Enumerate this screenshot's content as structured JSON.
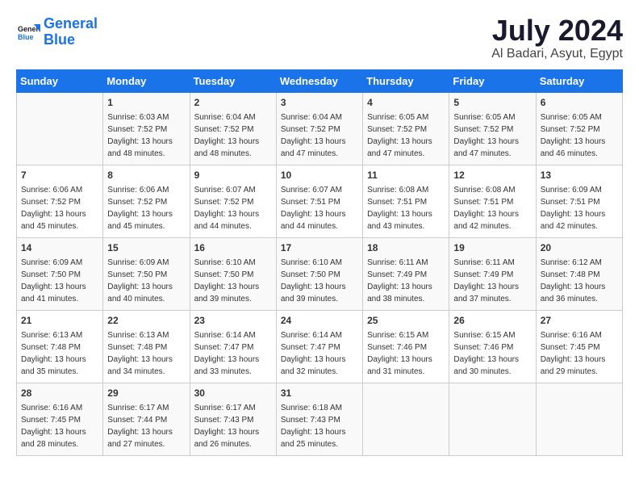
{
  "header": {
    "logo_line1": "General",
    "logo_line2": "Blue",
    "month": "July 2024",
    "location": "Al Badari, Asyut, Egypt"
  },
  "weekdays": [
    "Sunday",
    "Monday",
    "Tuesday",
    "Wednesday",
    "Thursday",
    "Friday",
    "Saturday"
  ],
  "weeks": [
    [
      {
        "day": "",
        "sunrise": "",
        "sunset": "",
        "daylight": ""
      },
      {
        "day": "1",
        "sunrise": "6:03 AM",
        "sunset": "7:52 PM",
        "daylight": "13 hours and 48 minutes."
      },
      {
        "day": "2",
        "sunrise": "6:04 AM",
        "sunset": "7:52 PM",
        "daylight": "13 hours and 48 minutes."
      },
      {
        "day": "3",
        "sunrise": "6:04 AM",
        "sunset": "7:52 PM",
        "daylight": "13 hours and 47 minutes."
      },
      {
        "day": "4",
        "sunrise": "6:05 AM",
        "sunset": "7:52 PM",
        "daylight": "13 hours and 47 minutes."
      },
      {
        "day": "5",
        "sunrise": "6:05 AM",
        "sunset": "7:52 PM",
        "daylight": "13 hours and 47 minutes."
      },
      {
        "day": "6",
        "sunrise": "6:05 AM",
        "sunset": "7:52 PM",
        "daylight": "13 hours and 46 minutes."
      }
    ],
    [
      {
        "day": "7",
        "sunrise": "6:06 AM",
        "sunset": "7:52 PM",
        "daylight": "13 hours and 45 minutes."
      },
      {
        "day": "8",
        "sunrise": "6:06 AM",
        "sunset": "7:52 PM",
        "daylight": "13 hours and 45 minutes."
      },
      {
        "day": "9",
        "sunrise": "6:07 AM",
        "sunset": "7:52 PM",
        "daylight": "13 hours and 44 minutes."
      },
      {
        "day": "10",
        "sunrise": "6:07 AM",
        "sunset": "7:51 PM",
        "daylight": "13 hours and 44 minutes."
      },
      {
        "day": "11",
        "sunrise": "6:08 AM",
        "sunset": "7:51 PM",
        "daylight": "13 hours and 43 minutes."
      },
      {
        "day": "12",
        "sunrise": "6:08 AM",
        "sunset": "7:51 PM",
        "daylight": "13 hours and 42 minutes."
      },
      {
        "day": "13",
        "sunrise": "6:09 AM",
        "sunset": "7:51 PM",
        "daylight": "13 hours and 42 minutes."
      }
    ],
    [
      {
        "day": "14",
        "sunrise": "6:09 AM",
        "sunset": "7:50 PM",
        "daylight": "13 hours and 41 minutes."
      },
      {
        "day": "15",
        "sunrise": "6:09 AM",
        "sunset": "7:50 PM",
        "daylight": "13 hours and 40 minutes."
      },
      {
        "day": "16",
        "sunrise": "6:10 AM",
        "sunset": "7:50 PM",
        "daylight": "13 hours and 39 minutes."
      },
      {
        "day": "17",
        "sunrise": "6:10 AM",
        "sunset": "7:50 PM",
        "daylight": "13 hours and 39 minutes."
      },
      {
        "day": "18",
        "sunrise": "6:11 AM",
        "sunset": "7:49 PM",
        "daylight": "13 hours and 38 minutes."
      },
      {
        "day": "19",
        "sunrise": "6:11 AM",
        "sunset": "7:49 PM",
        "daylight": "13 hours and 37 minutes."
      },
      {
        "day": "20",
        "sunrise": "6:12 AM",
        "sunset": "7:48 PM",
        "daylight": "13 hours and 36 minutes."
      }
    ],
    [
      {
        "day": "21",
        "sunrise": "6:13 AM",
        "sunset": "7:48 PM",
        "daylight": "13 hours and 35 minutes."
      },
      {
        "day": "22",
        "sunrise": "6:13 AM",
        "sunset": "7:48 PM",
        "daylight": "13 hours and 34 minutes."
      },
      {
        "day": "23",
        "sunrise": "6:14 AM",
        "sunset": "7:47 PM",
        "daylight": "13 hours and 33 minutes."
      },
      {
        "day": "24",
        "sunrise": "6:14 AM",
        "sunset": "7:47 PM",
        "daylight": "13 hours and 32 minutes."
      },
      {
        "day": "25",
        "sunrise": "6:15 AM",
        "sunset": "7:46 PM",
        "daylight": "13 hours and 31 minutes."
      },
      {
        "day": "26",
        "sunrise": "6:15 AM",
        "sunset": "7:46 PM",
        "daylight": "13 hours and 30 minutes."
      },
      {
        "day": "27",
        "sunrise": "6:16 AM",
        "sunset": "7:45 PM",
        "daylight": "13 hours and 29 minutes."
      }
    ],
    [
      {
        "day": "28",
        "sunrise": "6:16 AM",
        "sunset": "7:45 PM",
        "daylight": "13 hours and 28 minutes."
      },
      {
        "day": "29",
        "sunrise": "6:17 AM",
        "sunset": "7:44 PM",
        "daylight": "13 hours and 27 minutes."
      },
      {
        "day": "30",
        "sunrise": "6:17 AM",
        "sunset": "7:43 PM",
        "daylight": "13 hours and 26 minutes."
      },
      {
        "day": "31",
        "sunrise": "6:18 AM",
        "sunset": "7:43 PM",
        "daylight": "13 hours and 25 minutes."
      },
      {
        "day": "",
        "sunrise": "",
        "sunset": "",
        "daylight": ""
      },
      {
        "day": "",
        "sunrise": "",
        "sunset": "",
        "daylight": ""
      },
      {
        "day": "",
        "sunrise": "",
        "sunset": "",
        "daylight": ""
      }
    ]
  ]
}
